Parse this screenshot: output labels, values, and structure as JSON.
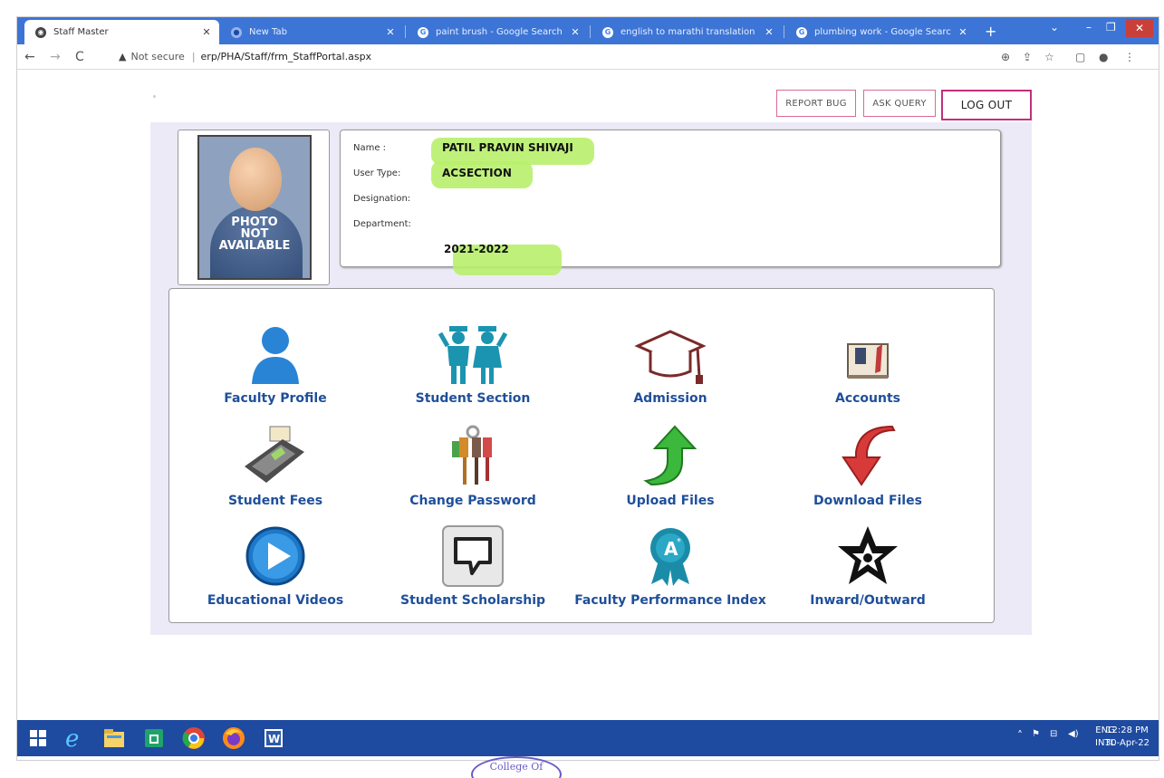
{
  "browser": {
    "tabs": [
      {
        "label": "Staff Master",
        "favicon": "globe-icon"
      },
      {
        "label": "New Tab",
        "favicon": "chrome-icon"
      },
      {
        "label": "paint brush - Google Search",
        "favicon": "google-icon"
      },
      {
        "label": "english to marathi translation",
        "favicon": "google-icon"
      },
      {
        "label": "plumbing work - Google Searc",
        "favicon": "google-icon"
      }
    ],
    "new_tab": "+",
    "not_secure": "Not secure",
    "url": "erp/PHA/Staff/frm_StaffPortal.aspx"
  },
  "header_buttons": {
    "report_bug": "REPORT BUG",
    "ask_query": "ASK QUERY",
    "log_out": "LOG OUT"
  },
  "profile": {
    "photo_text_1": "PHOTO",
    "photo_text_2": "NOT",
    "photo_text_3": "AVAILABLE",
    "name_label": "Name :",
    "name_value": "PATIL PRAVIN SHIVAJI",
    "usertype_label": "User Type:",
    "usertype_value": "ACSECTION",
    "designation_label": "Designation:",
    "department_label": "Department:",
    "year_value": "2021-2022",
    "highlight_color": "#b8f06b"
  },
  "modules": [
    {
      "label": "Faculty Profile",
      "icon": "person-icon"
    },
    {
      "label": "Student Section",
      "icon": "students-icon"
    },
    {
      "label": "Admission",
      "icon": "graduation-cap-icon"
    },
    {
      "label": "Accounts",
      "icon": "book-icon"
    },
    {
      "label": "Student Fees",
      "icon": "card-machine-icon"
    },
    {
      "label": "Change Password",
      "icon": "keys-icon"
    },
    {
      "label": "Upload Files",
      "icon": "upload-arrow-icon"
    },
    {
      "label": "Download Files",
      "icon": "download-arrow-icon"
    },
    {
      "label": "Educational Videos",
      "icon": "play-icon"
    },
    {
      "label": "Student Scholarship",
      "icon": "chat-bubble-icon"
    },
    {
      "label": "Faculty Performance Index",
      "icon": "award-ribbon-icon"
    },
    {
      "label": "Inward/Outward",
      "icon": "star-arrows-icon"
    }
  ],
  "taskbar": {
    "lang_1": "ENG",
    "lang_2": "INTL",
    "time": "12:28 PM",
    "date": "30-Apr-22"
  },
  "stamp_text": "College Of"
}
